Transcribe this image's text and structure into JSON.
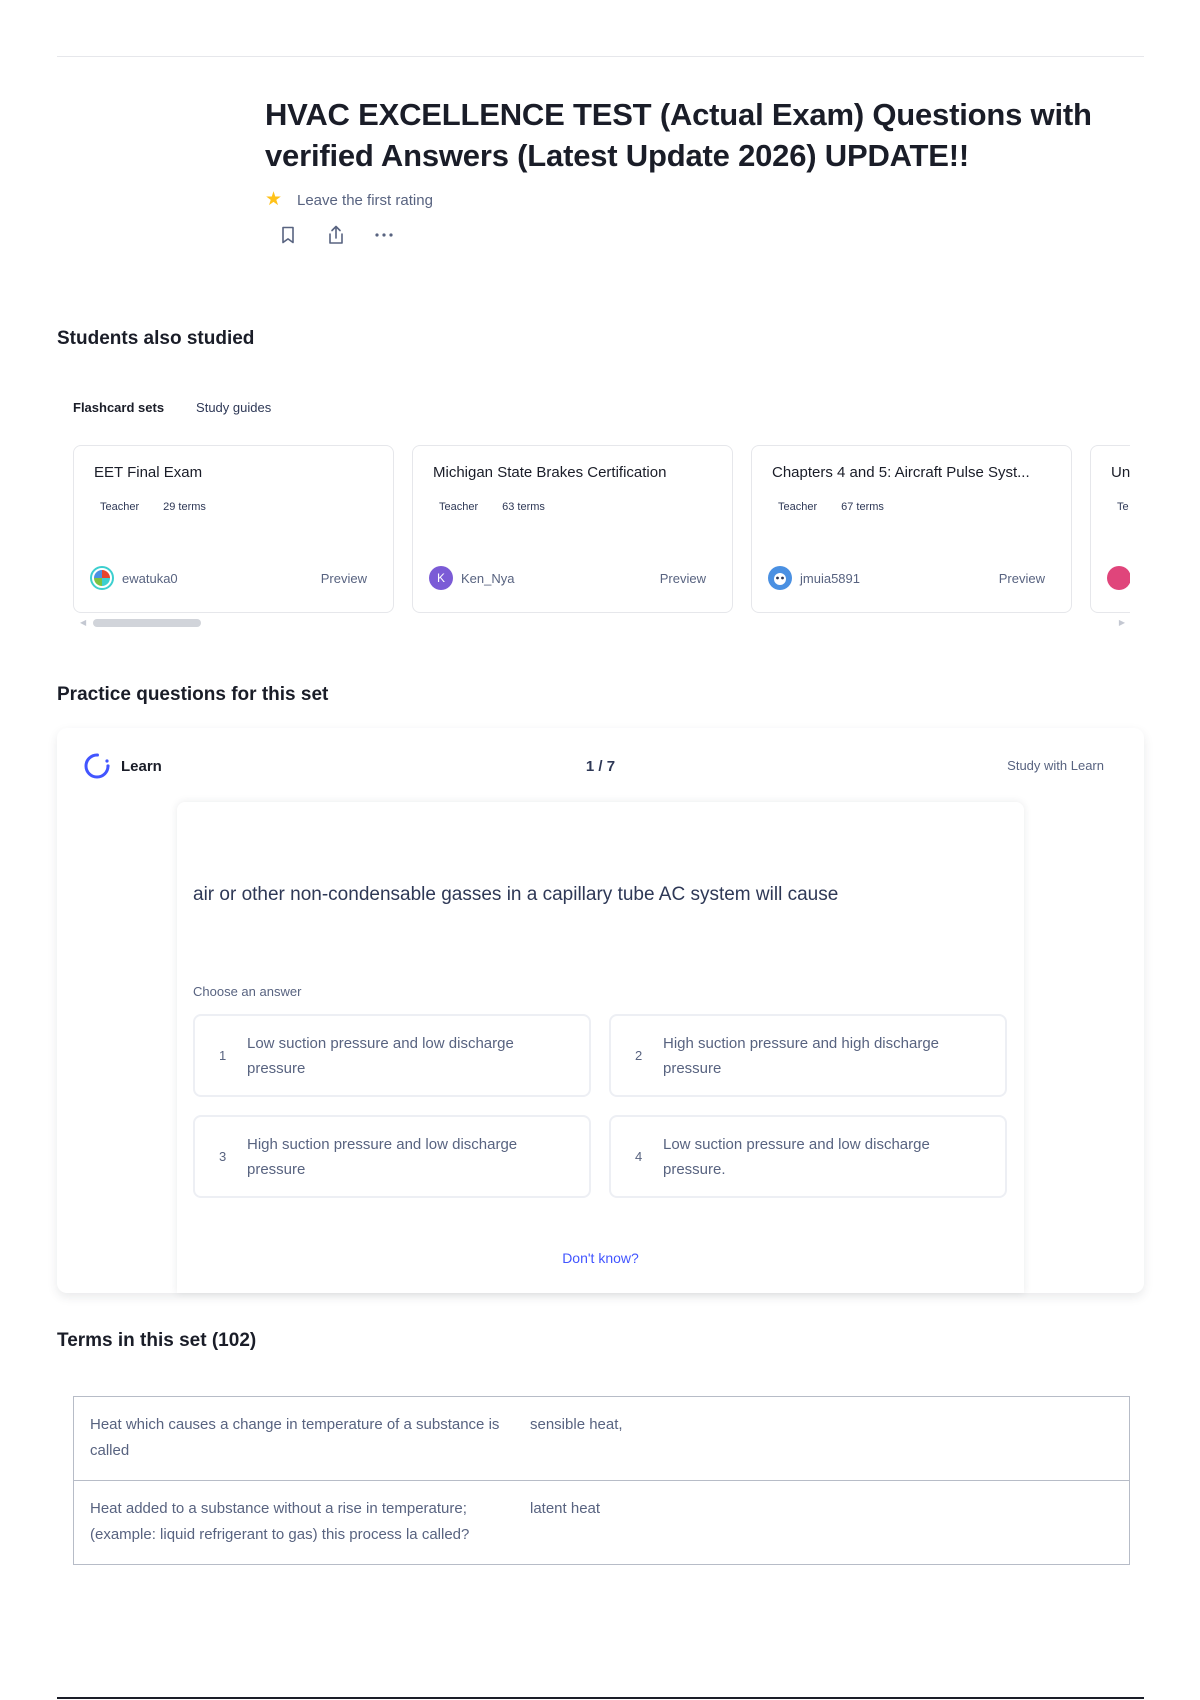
{
  "header": {
    "title": "HVAC EXCELLENCE TEST (Actual Exam) Questions with verified Answers (Latest Update 2026) UPDATE!!",
    "rating_text": "Leave the first rating"
  },
  "students_also_studied": {
    "heading": "Students also studied",
    "tabs": [
      {
        "label": "Flashcard sets",
        "active": true
      },
      {
        "label": "Study guides",
        "active": false
      }
    ],
    "cards": [
      {
        "title": "EET Final Exam",
        "role": "Teacher",
        "terms": "29 terms",
        "user": "ewatuka0",
        "preview": "Preview",
        "avatar_color": "#3ccfcf"
      },
      {
        "title": "Michigan State Brakes Certification",
        "role": "Teacher",
        "terms": "63 terms",
        "user": "Ken_Nya",
        "preview": "Preview",
        "avatar_letter": "K",
        "avatar_color": "#7b5bd6"
      },
      {
        "title": "Chapters 4 and 5: Aircraft Pulse Syst...",
        "role": "Teacher",
        "terms": "67 terms",
        "user": "jmuia5891",
        "preview": "Preview",
        "avatar_color": "#4a90e2"
      },
      {
        "title": "Un",
        "role": "Te",
        "terms": "",
        "user": "",
        "preview": "",
        "avatar_color": "#e0457b"
      }
    ]
  },
  "practice": {
    "heading": "Practice questions for this set",
    "mode_label": "Learn",
    "counter": "1 / 7",
    "study_link": "Study with Learn",
    "question": "air or other non-condensable gasses in a capillary tube AC system will cause",
    "choose_label": "Choose an answer",
    "answers": [
      {
        "num": "1",
        "text": "Low suction pressure and low discharge pressure"
      },
      {
        "num": "2",
        "text": "High suction pressure and high discharge pressure"
      },
      {
        "num": "3",
        "text": "High suction pressure and low discharge pressure"
      },
      {
        "num": "4",
        "text": "Low suction pressure and low discharge pressure."
      }
    ],
    "dont_know": "Don't know?"
  },
  "terms": {
    "heading": "Terms in this set (102)",
    "rows": [
      {
        "term": "Heat which causes a change in temperature of a substance is called",
        "definition": "sensible heat,"
      },
      {
        "term": "Heat added to a substance without a rise in temperature; (example: liquid refrigerant to gas) this process la called?",
        "definition": "latent heat"
      }
    ]
  },
  "colors": {
    "accent": "#4255ff",
    "star": "#ffc21a",
    "text_dark": "#1a1d28",
    "text_muted": "#586380"
  }
}
